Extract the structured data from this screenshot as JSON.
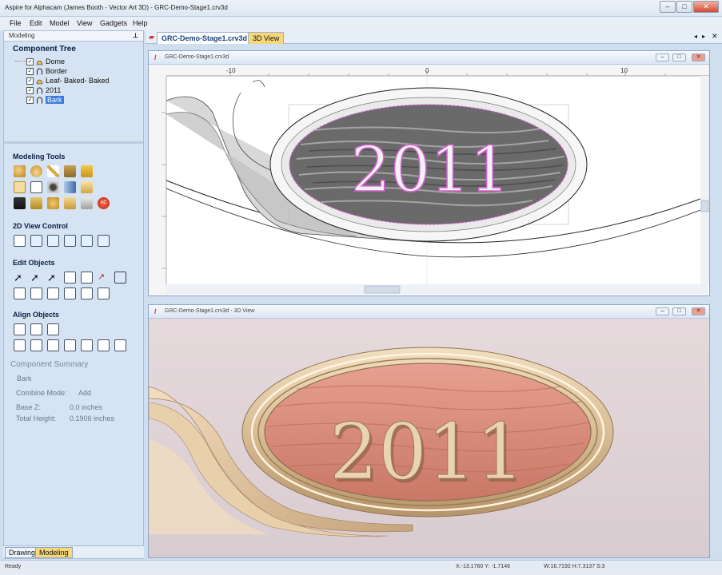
{
  "app": {
    "title": "Aspire for Alphacam (James Booth - Vector Art 3D) - GRC-Demo-Stage1.crv3d"
  },
  "menu": [
    "File",
    "Edit",
    "Model",
    "View",
    "Gadgets",
    "Help"
  ],
  "panel": {
    "header": "Modeling",
    "component_tree_title": "Component Tree",
    "tree": [
      {
        "label": "Dome",
        "checked": true
      },
      {
        "label": "Border",
        "checked": true
      },
      {
        "label": "Leaf- Baked- Baked",
        "checked": true
      },
      {
        "label": "2011",
        "checked": true
      },
      {
        "label": "Bark",
        "checked": true,
        "selected": true
      }
    ],
    "modeling_tools_title": "Modeling Tools",
    "view_control_title": "2D View Control",
    "edit_objects_title": "Edit Objects",
    "align_objects_title": "Align Objects",
    "summary": {
      "title": "Component Summary",
      "name": "Bark",
      "combine_label": "Combine Mode:",
      "combine_value": "Add",
      "basez_label": "Base Z:",
      "basez_value": "0.0 inches",
      "height_label": "Total Height:",
      "height_value": "0.1906 inches"
    }
  },
  "bottom_tabs": [
    "Drawing",
    "Modeling"
  ],
  "doc_tabs": [
    "GRC-Demo-Stage1.crv3d",
    "3D View"
  ],
  "view2d": {
    "title": "GRC-Demo-Stage1.crv3d",
    "ruler_labels": [
      "-10",
      "0",
      "10"
    ],
    "plaque_text": "2011"
  },
  "view3d": {
    "title": "GRC-Demo-Stage1.crv3d - 3D View",
    "plaque_text": "2011"
  },
  "status": {
    "left": "Ready",
    "coords": "X:-13.1760 Y: -1.7146",
    "size": "W:16.7192   H:7.3137   S:3"
  },
  "colors": {
    "accent": "#3d7bd9",
    "plaque_3d": "#d98a7c",
    "frame_3d": "#e3c9a4"
  }
}
